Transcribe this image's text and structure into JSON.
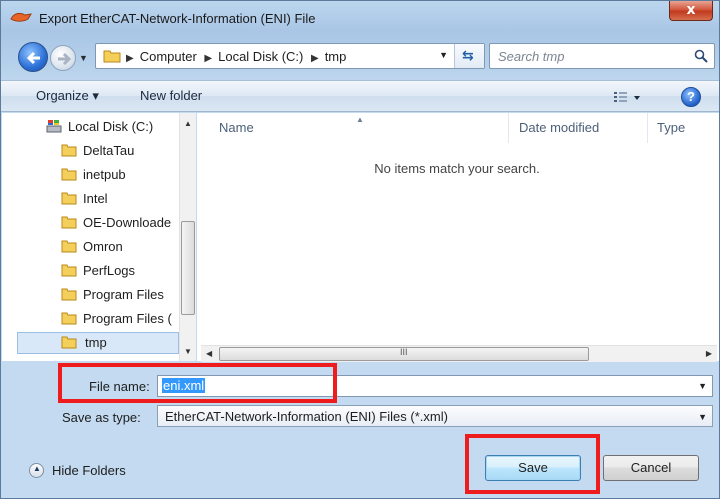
{
  "window": {
    "title": "Export EtherCAT-Network-Information (ENI) File",
    "close_label": "x"
  },
  "nav": {
    "breadcrumbs": [
      "Computer",
      "Local Disk (C:)",
      "tmp"
    ],
    "search_placeholder": "Search tmp"
  },
  "toolbar": {
    "organize_label": "Organize ▾",
    "new_folder_label": "New folder",
    "help_label": "?"
  },
  "tree": {
    "drive_label": "Local Disk (C:)",
    "folders": [
      "DeltaTau",
      "inetpub",
      "Intel",
      "OE-Downloade",
      "Omron",
      "PerfLogs",
      "Program Files",
      "Program Files (",
      "tmp"
    ],
    "selected": "tmp"
  },
  "file_list": {
    "columns": [
      "Name",
      "Date modified",
      "Type"
    ],
    "empty_message": "No items match your search.",
    "scroll_grip": "III"
  },
  "form": {
    "file_name_label": "File name:",
    "file_name_value": "eni.xml",
    "save_type_label": "Save as type:",
    "save_type_value": "EtherCAT-Network-Information (ENI) Files (*.xml)"
  },
  "footer": {
    "hide_folders_label": "Hide Folders",
    "save_label": "Save",
    "cancel_label": "Cancel"
  },
  "colors": {
    "highlight": "#ee1c1c",
    "selection": "#3399ff",
    "window_frame": "#b4cfea"
  }
}
